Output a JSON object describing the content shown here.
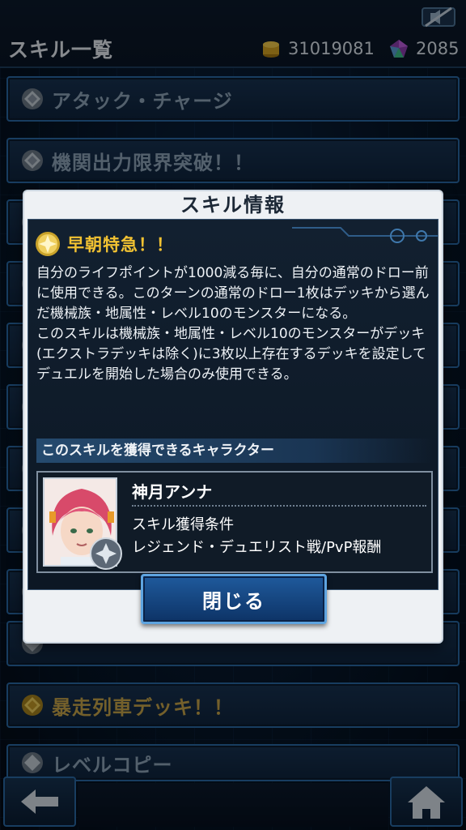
{
  "header": {
    "title": "スキル一覧",
    "coins": "31019081",
    "gems": "2085"
  },
  "skill_list": [
    {
      "label": "アタック・チャージ",
      "icon": "silver-diamond-icon"
    },
    {
      "label": "機関出力限界突破！！",
      "icon": "silver-diamond-icon"
    },
    {
      "label": "",
      "icon": "silver-diamond-icon"
    },
    {
      "label": "",
      "icon": "silver-diamond-icon"
    },
    {
      "label": "",
      "icon": "silver-diamond-icon"
    },
    {
      "label": "",
      "icon": "silver-diamond-icon"
    },
    {
      "label": "",
      "icon": "silver-diamond-icon"
    },
    {
      "label": "",
      "icon": "silver-diamond-icon"
    },
    {
      "label": "",
      "icon": "silver-diamond-icon"
    },
    {
      "label": "暴走列車デッキ！！",
      "icon": "gold-diamond-icon"
    },
    {
      "label": "レベルコピー",
      "icon": "silver-diamond-icon"
    }
  ],
  "modal": {
    "title": "スキル情報",
    "skill_name": "早朝特急！！",
    "description": [
      "自分のライフポイントが1000減る毎に、自分の通常のドロー前に使用できる。このターンの通常のドロー1枚はデッキから選んだ機械族・地属性・レベル10のモンスターになる。",
      "このスキルは機械族・地属性・レベル10のモンスターがデッキ(エクストラデッキは除く)に3枚以上存在するデッキを設定してデュエルを開始した場合のみ使用できる。"
    ],
    "character_section_label": "このスキルを獲得できるキャラクター",
    "character": {
      "name": "神月アンナ",
      "condition_label": "スキル獲得条件",
      "condition_value": "レジェンド・デュエリスト戦/PvP報酬"
    },
    "close_label": "閉じる"
  },
  "colors": {
    "accent_gold": "#f2c232",
    "panel_blue": "#1f5a9c",
    "frame_blue": "#2a6aa6"
  }
}
